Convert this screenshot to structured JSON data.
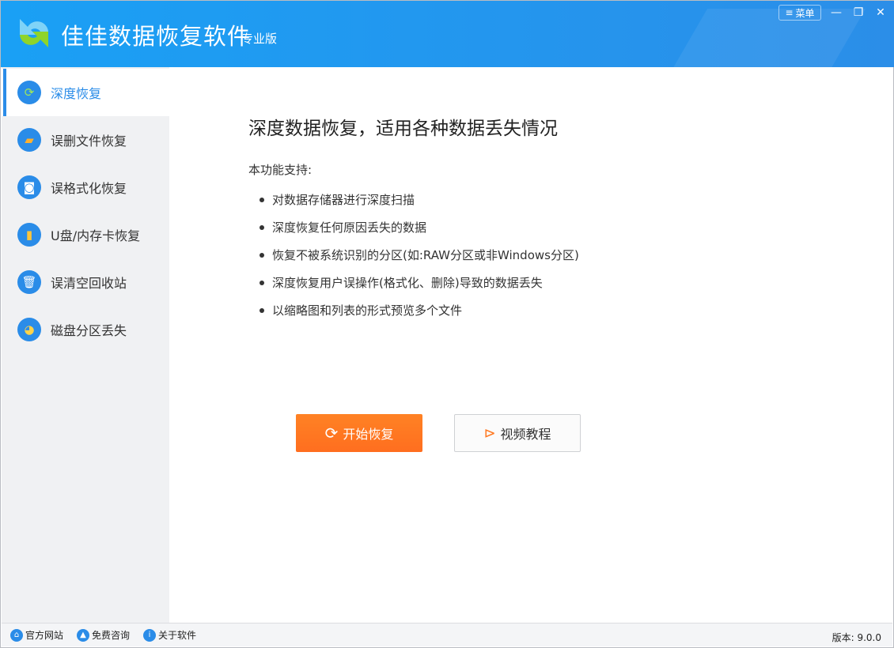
{
  "titlebar": {
    "title": "佳佳数据恢复软件",
    "edition": "专业版",
    "menu_label": "菜单",
    "minimize": "—",
    "restore": "❐",
    "close": "✕"
  },
  "sidebar": {
    "items": [
      {
        "label": "深度恢复",
        "icon": "refresh-icon"
      },
      {
        "label": "误删文件恢复",
        "icon": "folder-icon"
      },
      {
        "label": "误格式化恢复",
        "icon": "harddisk-icon"
      },
      {
        "label": "U盘/内存卡恢复",
        "icon": "usb-icon"
      },
      {
        "label": "误清空回收站",
        "icon": "recycle-bin-icon"
      },
      {
        "label": "磁盘分区丢失",
        "icon": "pie-icon"
      }
    ]
  },
  "main": {
    "heading": "深度数据恢复，适用各种数据丢失情况",
    "support_label": "本功能支持:",
    "features": [
      "对数据存储器进行深度扫描",
      "深度恢复任何原因丢失的数据",
      "恢复不被系统识别的分区(如:RAW分区或非Windows分区)",
      "深度恢复用户误操作(格式化、删除)导致的数据丢失",
      "以缩略图和列表的形式预览多个文件"
    ],
    "start_button": "开始恢复",
    "video_button": "视频教程"
  },
  "footer": {
    "links": [
      "官方网站",
      "免费咨询",
      "关于软件"
    ],
    "version": "版本: 9.0.0"
  },
  "colors": {
    "accent": "#2a8ce8",
    "orange": "#ff7820"
  }
}
